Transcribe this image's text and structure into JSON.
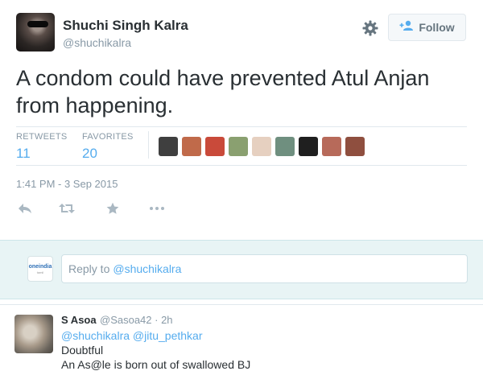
{
  "tweet": {
    "author": {
      "full_name": "Shuchi Singh Kalra",
      "handle": "@shuchikalra"
    },
    "follow_label": "Follow",
    "text": "A condom could have prevented Atul Anjan from happening.",
    "stats": {
      "retweets_label": "RETWEETS",
      "retweets_value": "11",
      "favorites_label": "FAVORITES",
      "favorites_value": "20"
    },
    "favoriters": [
      "#3f3f3f",
      "#c06a4a",
      "#c94a3a",
      "#8aa070",
      "#e6d0c0",
      "#6f8f7f",
      "#1f1f1f",
      "#b76a5a",
      "#8f4f3f"
    ],
    "timestamp": "1:41 PM - 3 Sep 2015",
    "actions": [
      "reply-icon",
      "retweet-icon",
      "favorite-icon",
      "more-icon"
    ]
  },
  "reply_bar": {
    "logo_text": "oneindia",
    "logo_sub": "tamil",
    "prompt": "Reply to",
    "handle": "@shuchikalra"
  },
  "reply": {
    "name": "S Asoa",
    "meta": "@Sasoa42 · 2h",
    "mentions": "@shuchikalra @jitu_pethkar",
    "line1": "Doubtful",
    "line2": "An As@le is born out of swallowed BJ"
  },
  "colors": {
    "accent": "#55acee",
    "muted": "#8899a6",
    "text": "#292f33",
    "reply_bg": "#e8f4f5"
  }
}
